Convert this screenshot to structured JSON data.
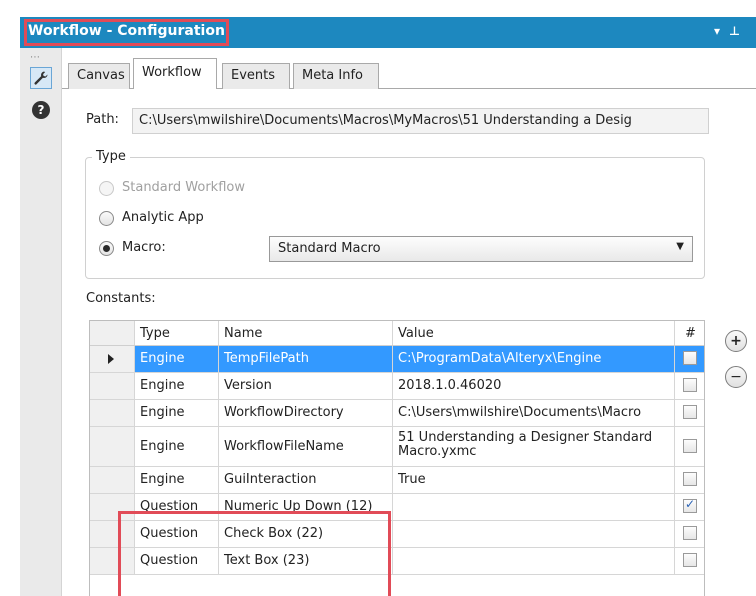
{
  "window": {
    "title": "Workflow - Configuration",
    "controls": {
      "dropdown": "▾",
      "pin": "⊥"
    }
  },
  "sidebar": {
    "grip": "⋯",
    "items": [
      {
        "icon": "wrench-icon",
        "glyph": "🔧"
      },
      {
        "icon": "help-icon",
        "glyph": "?"
      }
    ]
  },
  "tabs": [
    "Canvas",
    "Workflow",
    "Events",
    "Meta Info"
  ],
  "active_tab": "Workflow",
  "path": {
    "label": "Path:",
    "value": "C:\\Users\\mwilshire\\Documents\\Macros\\MyMacros\\51 Understanding a Desig"
  },
  "type_group": {
    "legend": "Type",
    "options": [
      {
        "label": "Standard Workflow",
        "disabled": true,
        "checked": false
      },
      {
        "label": "Analytic App",
        "disabled": false,
        "checked": false
      },
      {
        "label": "Macro:",
        "disabled": false,
        "checked": true
      }
    ],
    "macro_select": "Standard Macro"
  },
  "constants": {
    "label": "Constants:",
    "columns": [
      "Type",
      "Name",
      "Value",
      "#"
    ],
    "rows": [
      {
        "type": "Engine",
        "name": "TempFilePath",
        "value": "C:\\ProgramData\\Alteryx\\Engine",
        "checked": false,
        "selected": true
      },
      {
        "type": "Engine",
        "name": "Version",
        "value": "2018.1.0.46020",
        "checked": false,
        "selected": false
      },
      {
        "type": "Engine",
        "name": "WorkflowDirectory",
        "value": "C:\\Users\\mwilshire\\Documents\\Macro",
        "checked": false,
        "selected": false
      },
      {
        "type": "Engine",
        "name": "WorkflowFileName",
        "value": "51 Understanding a Designer Standard Macro.yxmc",
        "checked": false,
        "selected": false
      },
      {
        "type": "Engine",
        "name": "GuiInteraction",
        "value": "True",
        "checked": false,
        "selected": false
      },
      {
        "type": "Question",
        "name": "Numeric Up Down (12)",
        "value": "",
        "checked": true,
        "selected": false
      },
      {
        "type": "Question",
        "name": "Check Box (22)",
        "value": "",
        "checked": false,
        "selected": false
      },
      {
        "type": "Question",
        "name": "Text Box (23)",
        "value": "",
        "checked": false,
        "selected": false
      }
    ],
    "add_button": "+",
    "remove_button": "−"
  },
  "colors": {
    "titlebar": "#1d88bf",
    "selection": "#3399ff",
    "highlight": "#e14b57"
  }
}
